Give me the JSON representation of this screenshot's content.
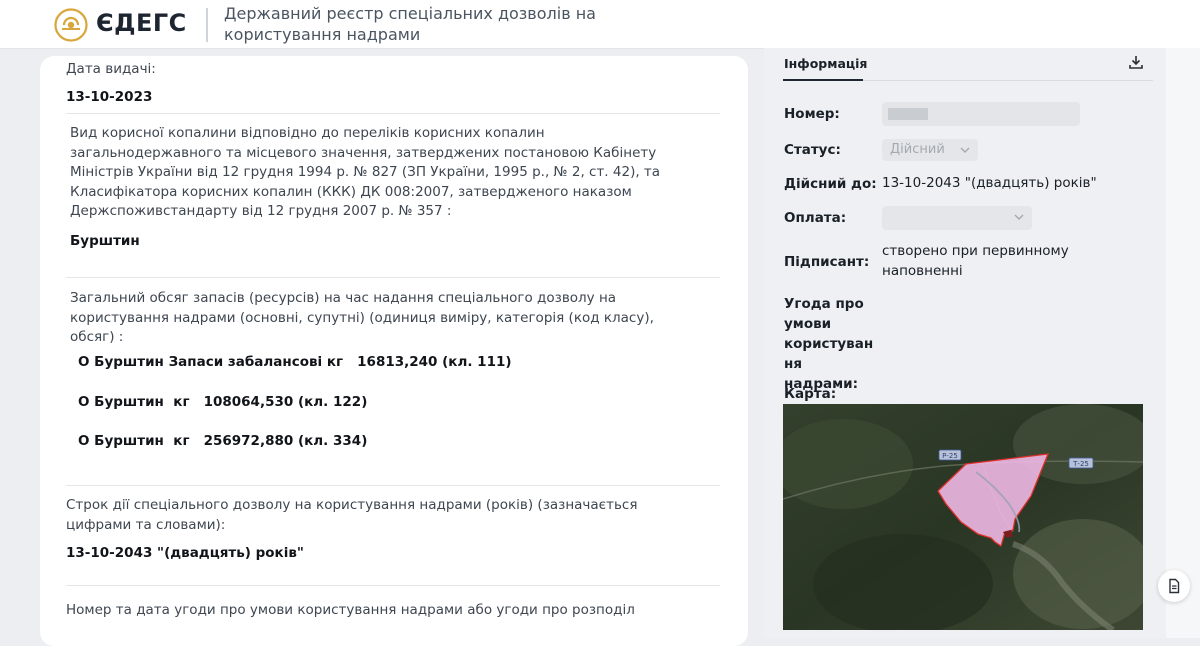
{
  "header": {
    "logo_text": "ЄДЕГС",
    "title": "Державний реєстр спеціальних дозволів на користування надрами"
  },
  "document": {
    "issue_date_label": "Дата видачі:",
    "issue_date_value": "13-10-2023",
    "mineral_label": "Вид корисної копалини відповідно до переліків корисних копалин загальнодержавного та місцевого значення, затверджених постановою Кабінету Міністрів України від 12 грудня 1994 р. № 827 (ЗП України, 1995 р., № 2, ст. 42), та Класифікатора корисних копалин (ККК) ДК 008:2007, затвердженого наказом Держспоживстандарту від 12 грудня 2007 р. № 357 :",
    "mineral_value": "Бурштин",
    "reserves_label": "Загальний обсяг запасів (ресурсів) на час надання спеціального дозволу на користування надрами (основні, супутні) (одиниця виміру, категорія (код класу), обсяг) :",
    "reserves_items": [
      "О Бурштин Запаси забалансові кг   16813,240 (кл. 111)",
      "О Бурштин  кг   108064,530 (кл. 122)",
      "О Бурштин  кг   256972,880 (кл. 334)"
    ],
    "term_label": "Строк дії спеціального дозволу на користування надрами (років) (зазначається цифрами та словами):",
    "term_value": "13-10-2043 \"(двадцять) років\"",
    "agreement_label": "Номер та дата угоди про умови користування надрами або угоди про розподіл"
  },
  "info_panel": {
    "tab_label": "Інформація",
    "number_label": "Номер:",
    "status_label": "Статус:",
    "status_value": "Дійсний",
    "valid_until_label": "Дійсний до:",
    "valid_until_value": "13-10-2043 \"(двадцять) років\"",
    "payment_label": "Оплата:",
    "signatory_label": "Підписант:",
    "signatory_value": "створено при первинному наповненні",
    "agreement_label": "Угода про умови користуван ня надрами:",
    "map_label": "Карта:"
  },
  "map": {
    "road_label_1": "Р-25",
    "road_label_2": "Т-25"
  },
  "colors": {
    "accent": "#1f2630",
    "polygon_fill": "#f0b8e6",
    "polygon_stroke": "#e0302a"
  },
  "icons": [
    "logo-icon",
    "download-icon",
    "chevron-down-icon",
    "document-icon"
  ]
}
